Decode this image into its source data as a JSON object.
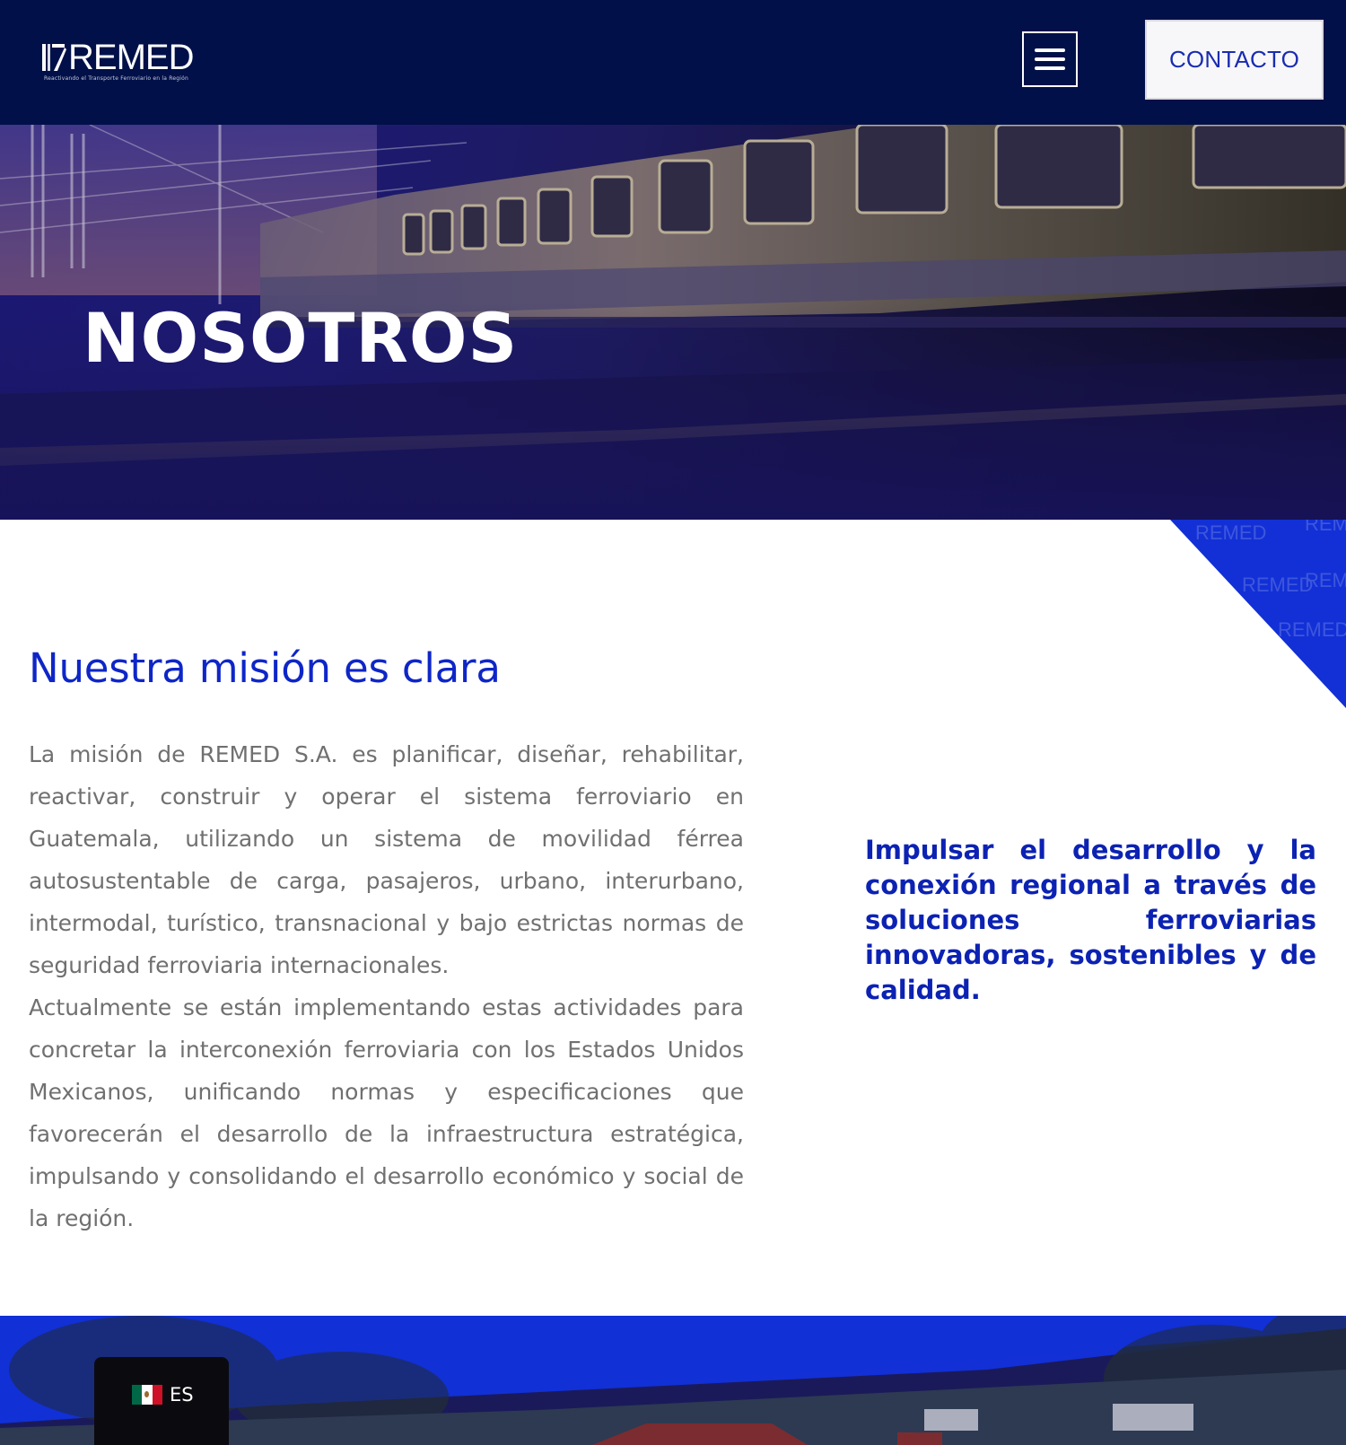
{
  "header": {
    "logo_text": "REMED",
    "logo_tagline": "Reactivando el Transporte Ferroviario en la Región",
    "contact_label": "CONTACTO"
  },
  "hero": {
    "title": "NOSOTROS"
  },
  "mission": {
    "title": "Nuestra misión es clara",
    "paragraph_1": "La misión de REMED S.A. es planificar, diseñar, rehabilitar, reactivar, construir y operar el sistema ferroviario en Guatemala, utilizando un sistema de movilidad férrea autosustentable de carga, pasajeros, urbano, interurbano, intermodal, turístico, transnacional y bajo estrictas normas de seguridad ferroviaria internacionales.",
    "paragraph_2": "Actualmente se están implementando estas actividades para concretar la interconexión ferroviaria con los Estados Unidos Mexicanos, unificando normas y especificaciones que favorecerán el desarrollo de la infraestructura estratégica, impulsando y consolidando el desarrollo económico y social de la región.",
    "quote": "Impulsar el desarrollo y la conexión regional a través de soluciones ferroviarias innovadoras, sostenibles y de calidad."
  },
  "corner_watermark": {
    "text": "REMED"
  },
  "language": {
    "label": "ES",
    "flag_colors": [
      "#006847",
      "#ffffff",
      "#ce1126"
    ]
  },
  "colors": {
    "header_bg": "#011048",
    "accent_blue": "#0e26c7",
    "band_blue": "#1230d6"
  }
}
